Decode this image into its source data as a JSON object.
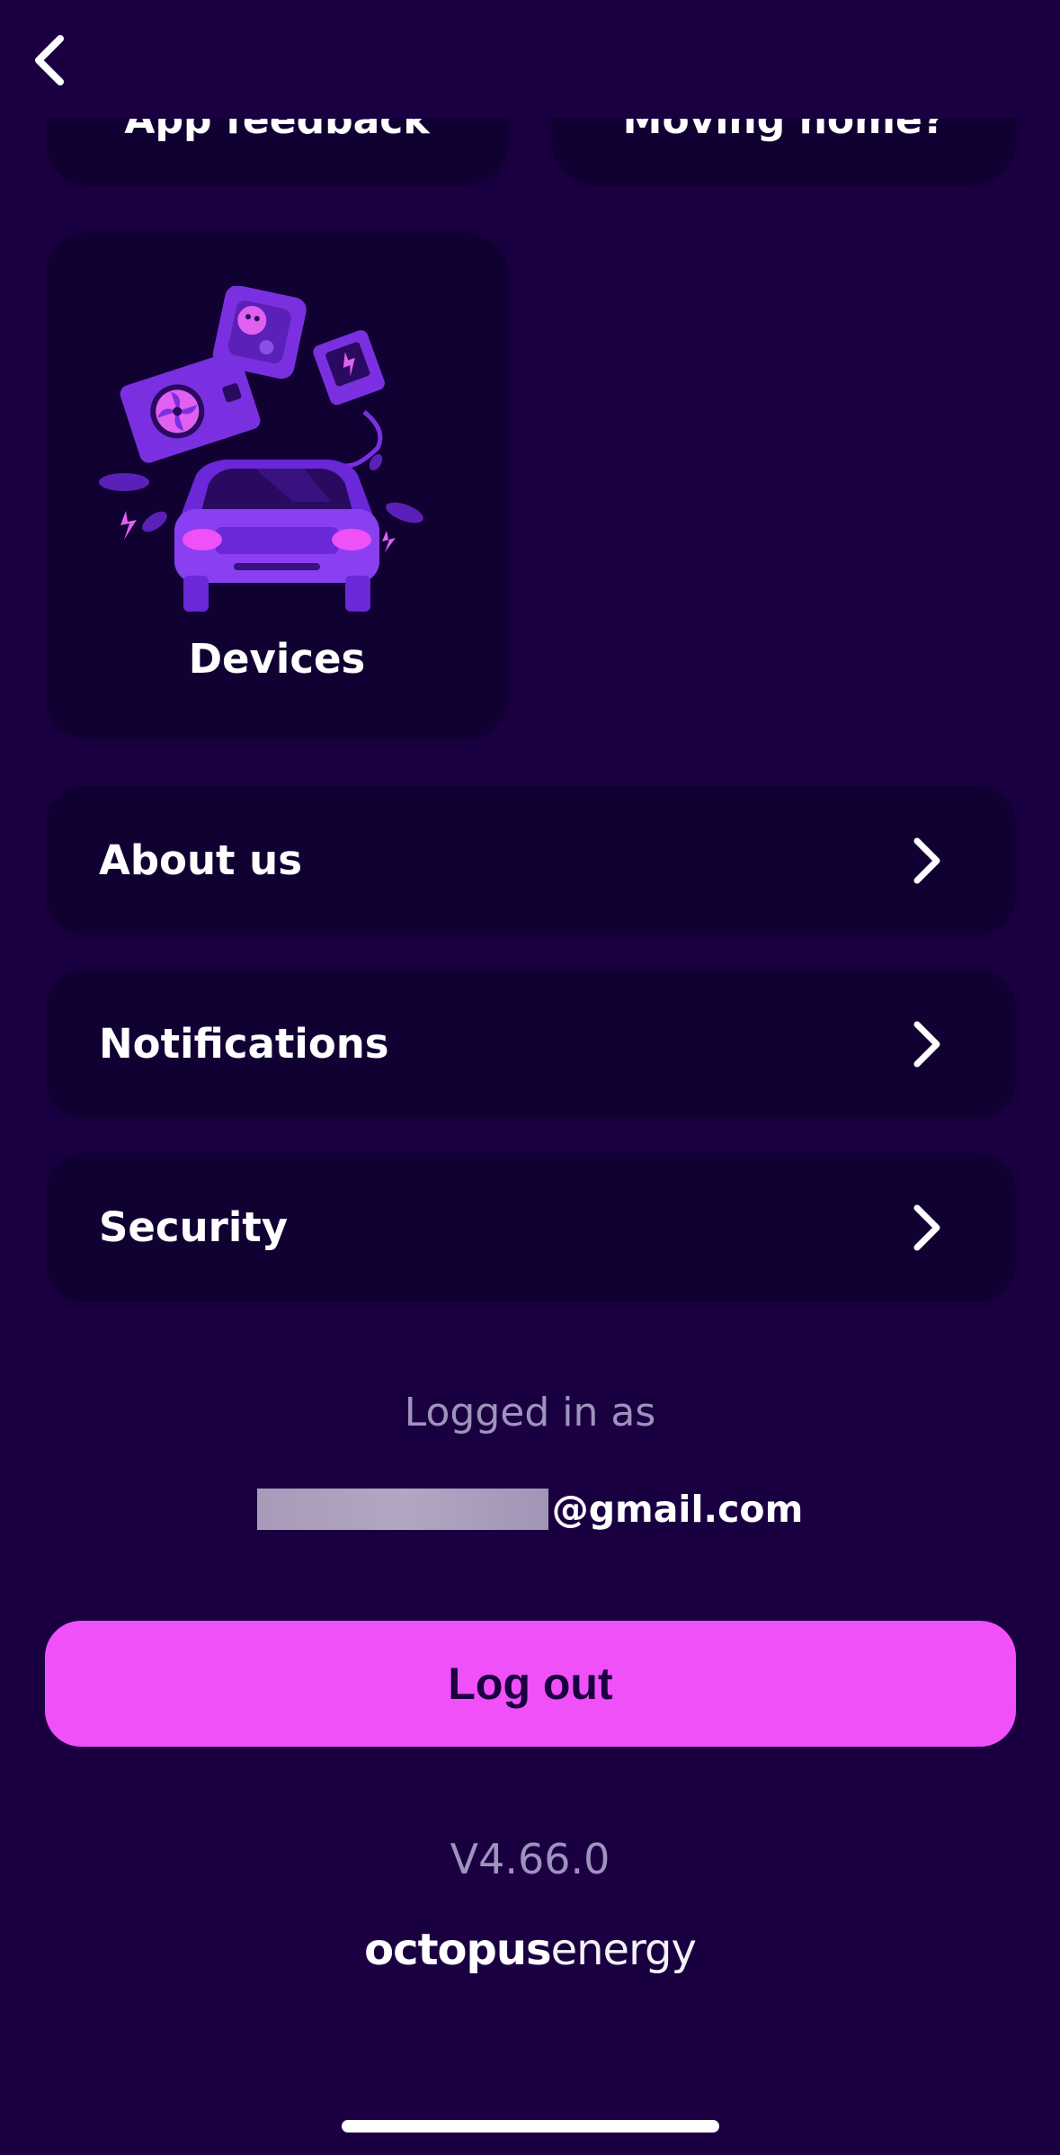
{
  "header": {
    "back_icon": "chevron-left-icon"
  },
  "tiles_cut": [
    "App feedback",
    "Moving home?"
  ],
  "devices_tile": {
    "label": "Devices",
    "illustration": "devices-illustration"
  },
  "menu": [
    {
      "label": "About us",
      "icon": "chevron-right-icon"
    },
    {
      "label": "Notifications",
      "icon": "chevron-right-icon"
    },
    {
      "label": "Security",
      "icon": "chevron-right-icon"
    }
  ],
  "account": {
    "logged_in_label": "Logged in as",
    "email_domain": "@gmail.com"
  },
  "logout_button": {
    "label": "Log out"
  },
  "version": "V4.66.0",
  "brand": {
    "part1": "octopus",
    "part2": "energy"
  },
  "colors": {
    "background": "#1a0041",
    "card": "#110032",
    "accent": "#f050f8",
    "muted_text": "#9e93bd"
  }
}
